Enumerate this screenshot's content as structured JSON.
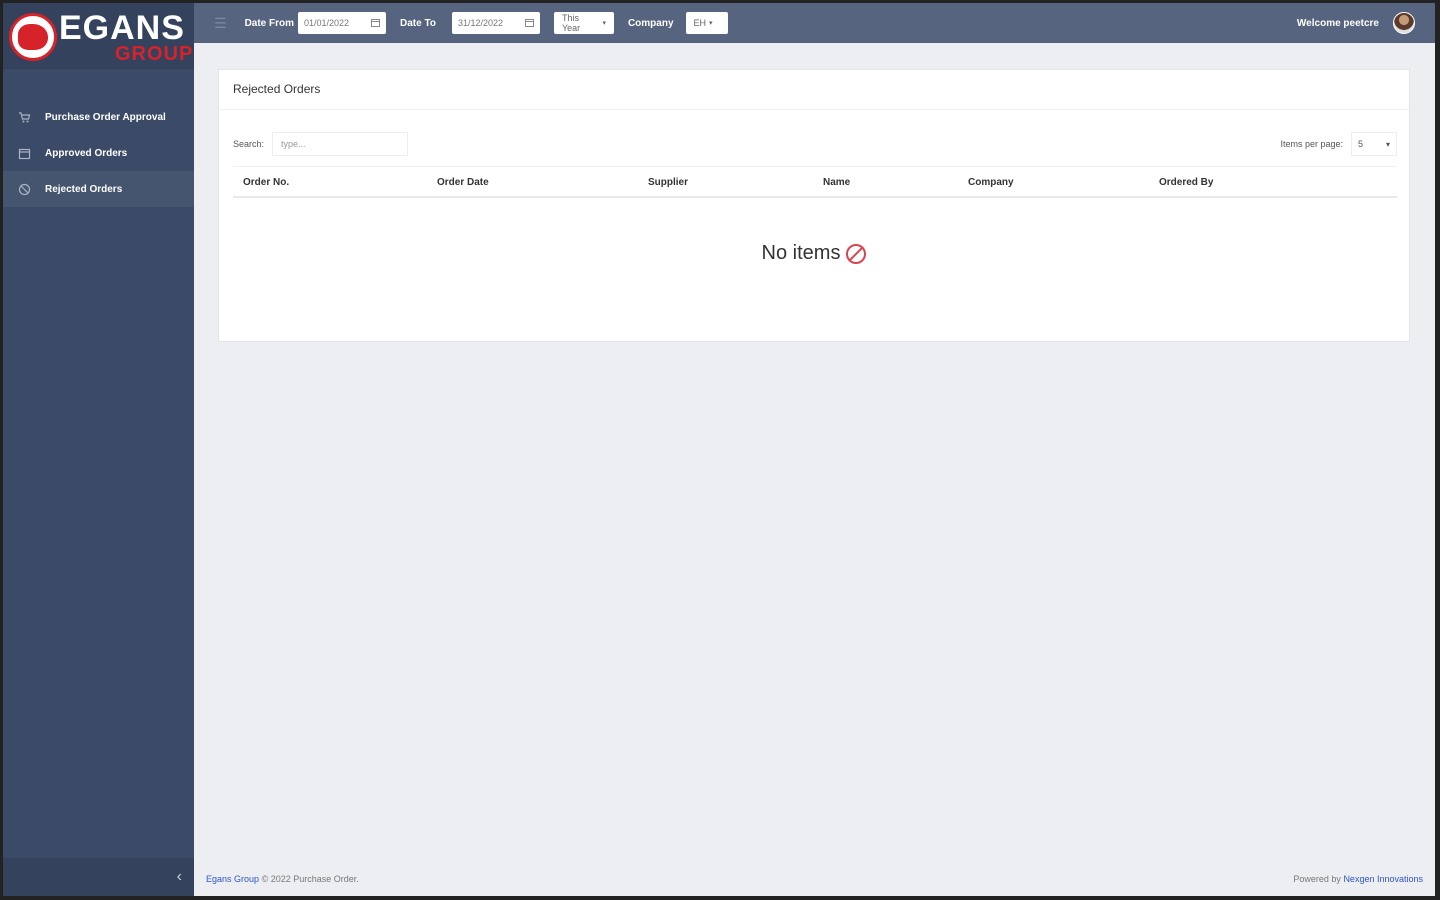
{
  "brand": {
    "name": "EGANS",
    "sub": "GROUP"
  },
  "sidebar": {
    "items": [
      {
        "label": "Purchase Order Approval",
        "icon": "cart-icon"
      },
      {
        "label": "Approved Orders",
        "icon": "calendar-icon"
      },
      {
        "label": "Rejected Orders",
        "icon": "ban-icon"
      }
    ],
    "collapse_glyph": "‹"
  },
  "topbar": {
    "hamburger_glyph": "☰",
    "date_from_label": "Date From",
    "date_from_value": "01/01/2022",
    "date_to_label": "Date To",
    "date_to_value": "31/12/2022",
    "period_value": "This Year",
    "company_label": "Company",
    "company_value": "EH",
    "welcome": "Welcome peetcre"
  },
  "card": {
    "title": "Rejected Orders",
    "search_label": "Search:",
    "search_placeholder": "type...",
    "perpage_label": "Items per page:",
    "perpage_value": "5",
    "columns": [
      "Order No.",
      "Order Date",
      "Supplier",
      "Name",
      "Company",
      "Ordered By"
    ],
    "empty_text": "No items"
  },
  "footer": {
    "left_link": "Egans Group",
    "left_text": "© 2022 Purchase Order.",
    "right_text": "Powered by",
    "right_link": "Nexgen Innovations"
  }
}
